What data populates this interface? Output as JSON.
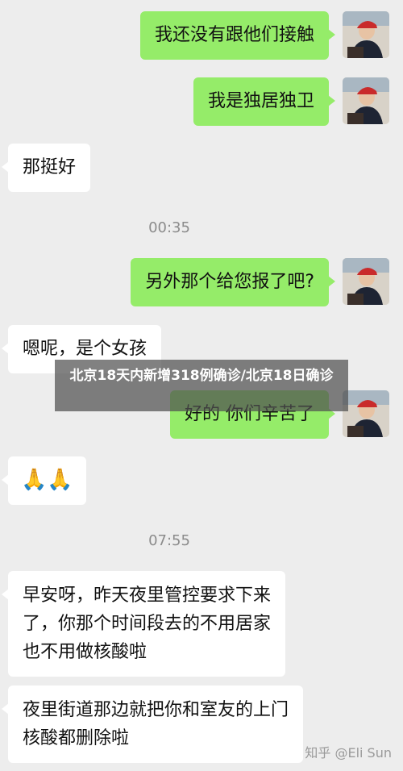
{
  "messages": [
    {
      "side": "out",
      "text": "我还没有跟他们接触"
    },
    {
      "side": "out",
      "text": "我是独居独卫"
    },
    {
      "side": "in",
      "text": "那挺好"
    },
    {
      "type": "time",
      "text": "00:35"
    },
    {
      "side": "out",
      "text": "另外那个给您报了吧?"
    },
    {
      "side": "in",
      "text": "嗯呢，是个女孩"
    },
    {
      "side": "out",
      "text": "好的 你们辛苦了"
    },
    {
      "side": "in",
      "text": "🙏🙏"
    },
    {
      "type": "time",
      "text": "07:55"
    },
    {
      "side": "in",
      "lines": [
        "早安呀，昨天夜里管控要求下来",
        "了，你那个时间段去的不用居家",
        "也不用做核酸啦"
      ]
    },
    {
      "side": "in",
      "lines": [
        "夜里街道那边就把你和室友的上门",
        "核酸都删除啦"
      ]
    }
  ],
  "overlay_title": "北京18天内新增318例确诊/北京18日确诊",
  "watermark": "知乎 @Eli Sun",
  "colors": {
    "outgoing_bubble": "#95ec69",
    "incoming_bubble": "#ffffff",
    "background": "#ededed"
  }
}
